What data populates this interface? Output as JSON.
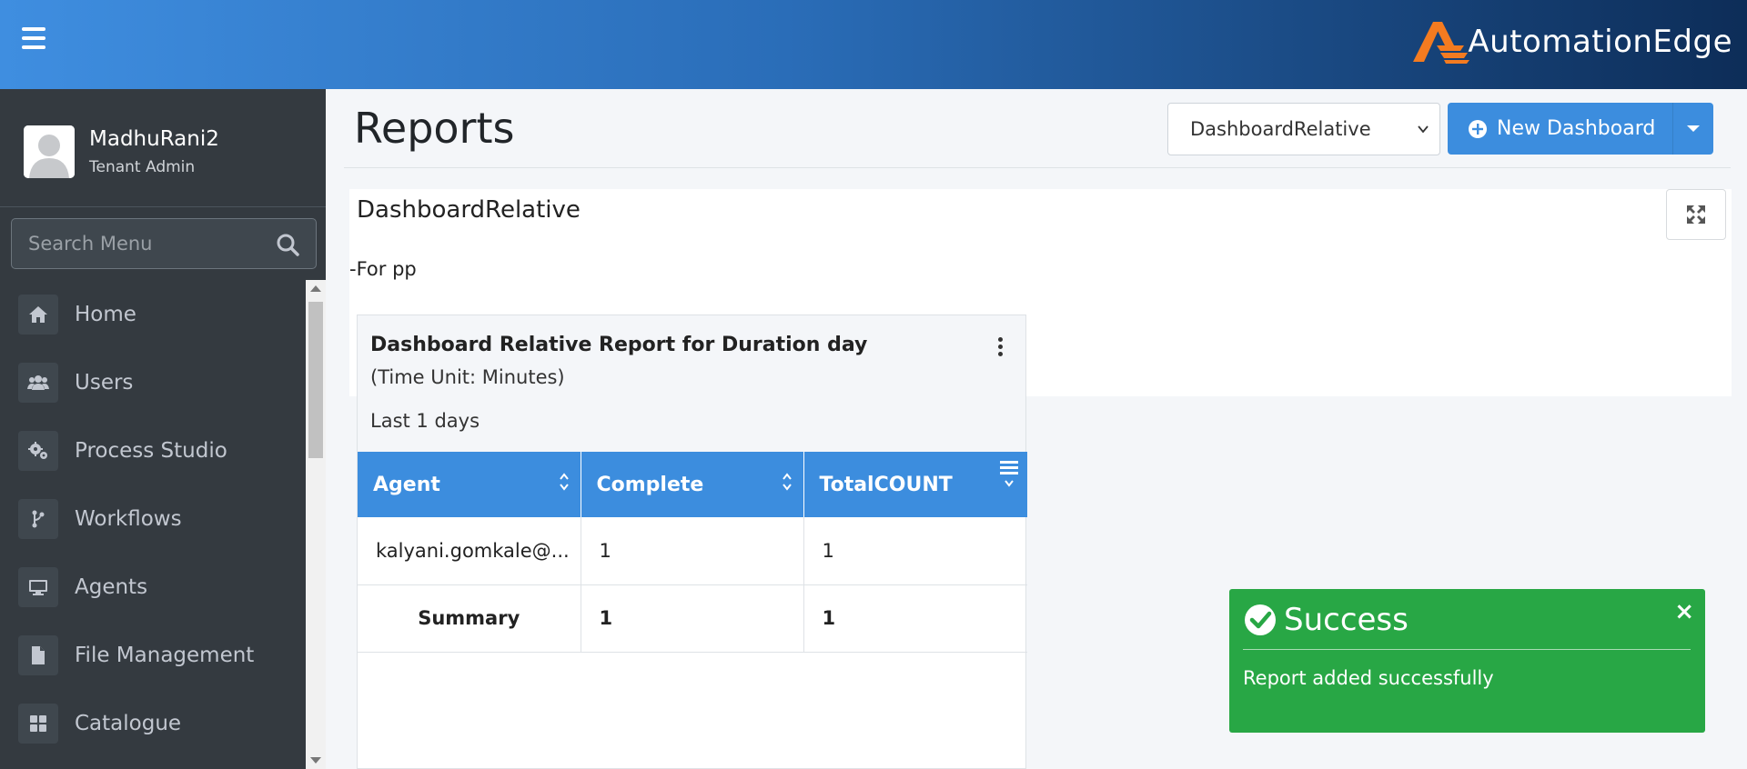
{
  "brand": {
    "name": "AutomationEdge",
    "accent": "#f47b20"
  },
  "user": {
    "name": "MadhuRani2",
    "role": "Tenant Admin"
  },
  "search": {
    "placeholder": "Search Menu"
  },
  "menu": {
    "items": [
      {
        "label": "Home",
        "icon": "home-icon"
      },
      {
        "label": "Users",
        "icon": "users-icon"
      },
      {
        "label": "Process Studio",
        "icon": "gears-icon"
      },
      {
        "label": "Workflows",
        "icon": "branch-icon"
      },
      {
        "label": "Agents",
        "icon": "desktop-icon"
      },
      {
        "label": "File Management",
        "icon": "file-icon"
      },
      {
        "label": "Catalogue",
        "icon": "grid-icon"
      }
    ]
  },
  "page": {
    "title": "Reports",
    "dashboard_select": "DashboardRelative",
    "new_dashboard_label": "New Dashboard"
  },
  "dashboard": {
    "name": "DashboardRelative",
    "description": "-For pp"
  },
  "report": {
    "title": "Dashboard Relative Report for Duration day",
    "subtitle": "(Time Unit: Minutes)",
    "range": "Last 1 days",
    "columns": [
      "Agent",
      "Complete",
      "TotalCOUNT"
    ],
    "rows": [
      [
        "kalyani.gomkale@...",
        "1",
        "1"
      ]
    ],
    "summary": {
      "label": "Summary",
      "complete": "1",
      "total": "1"
    }
  },
  "toast": {
    "title": "Success",
    "message": "Report added successfully",
    "close": "×"
  },
  "colors": {
    "primary": "#3c8dde",
    "success": "#28a745",
    "sidebar": "#343a40"
  }
}
